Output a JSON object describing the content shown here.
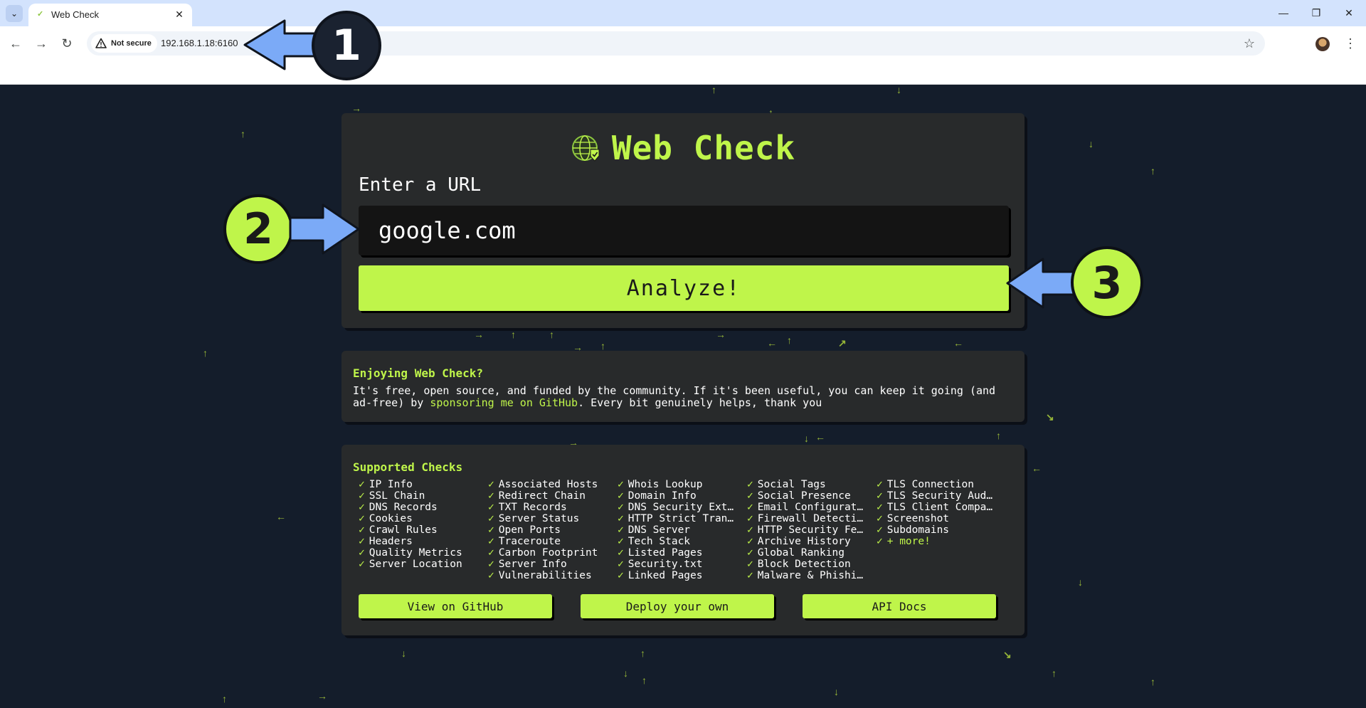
{
  "browser": {
    "tab": {
      "title": "Web Check"
    },
    "address": {
      "security_label": "Not secure",
      "url": "192.168.1.18:6160"
    }
  },
  "app": {
    "title": "Web Check",
    "url_label": "Enter a URL",
    "url_value": "google.com",
    "analyze_label": "Analyze!"
  },
  "sponsor": {
    "title": "Enjoying Web Check?",
    "text_before": "It's free, open source, and funded by the community. If it's been useful, you can keep it going (and ad-free) by ",
    "link": "sponsoring me on GitHub",
    "text_after": ". Every bit genuinely helps, thank you"
  },
  "checks": {
    "title": "Supported Checks",
    "columns": [
      [
        "IP Info",
        "SSL Chain",
        "DNS Records",
        "Cookies",
        "Crawl Rules",
        "Headers",
        "Quality Metrics",
        "Server Location"
      ],
      [
        "Associated Hosts",
        "Redirect Chain",
        "TXT Records",
        "Server Status",
        "Open Ports",
        "Traceroute",
        "Carbon Footprint",
        "Server Info",
        "Vulnerabilities"
      ],
      [
        "Whois Lookup",
        "Domain Info",
        "DNS Security Ext…",
        "HTTP Strict Tran…",
        "DNS Server",
        "Tech Stack",
        "Listed Pages",
        "Security.txt",
        "Linked Pages"
      ],
      [
        "Social Tags",
        "Social Presence",
        "Email Configurat…",
        "Firewall Detecti…",
        "HTTP Security Fe…",
        "Archive History",
        "Global Ranking",
        "Block Detection",
        "Malware & Phishi…"
      ],
      [
        "TLS Connection",
        "TLS Security Aud…",
        "TLS Client Compa…",
        "Screenshot",
        "Subdomains"
      ]
    ],
    "more_label": "+ more!",
    "buttons": {
      "github": "View on GitHub",
      "deploy": "Deploy your own",
      "api": "API Docs"
    }
  },
  "annotations": {
    "step1": "1",
    "step2": "2",
    "step3": "3"
  },
  "colors": {
    "accent": "#bff54a",
    "page_bg": "#141d2b",
    "card_bg": "#282a2b",
    "arrow": "#7baaf7"
  }
}
